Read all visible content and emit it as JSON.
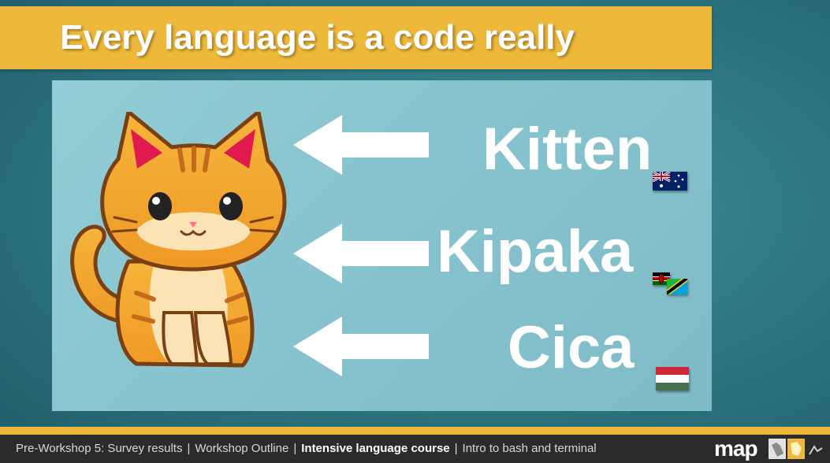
{
  "slide": {
    "title": "Every language is a code really"
  },
  "translations": [
    {
      "word": "Kitten",
      "flag_icon": "australia-flag-icon"
    },
    {
      "word": "Kipaka",
      "flag_icon": "kenya-tanzania-flags-icon"
    },
    {
      "word": "Cica",
      "flag_icon": "hungary-flag-icon"
    }
  ],
  "footer": {
    "items": [
      "Pre-Workshop 5: Survey results",
      "Workshop Outline",
      "Intensive language course",
      "Intro to bash and terminal"
    ],
    "separator": "|",
    "active_index": 2,
    "logo": "map"
  },
  "colors": {
    "accent": "#eeb83a",
    "background": "#2f7883",
    "panel": "#8cc8d2",
    "footer": "#2b2b2b"
  }
}
